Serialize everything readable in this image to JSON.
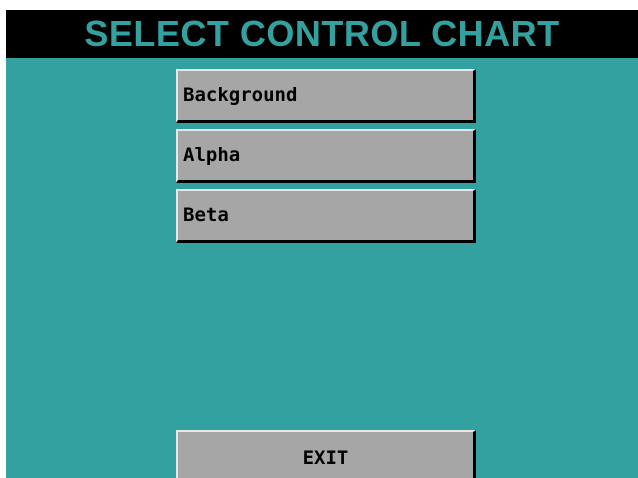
{
  "title": "SELECT CONTROL CHART",
  "menu": {
    "items": [
      {
        "label": "Background"
      },
      {
        "label": "Alpha"
      },
      {
        "label": "Beta"
      }
    ]
  },
  "exit_label": "EXIT",
  "colors": {
    "background": "#33a1a0",
    "title_bar": "#000000",
    "title_text": "#33a1a0",
    "button_face": "#a6a6a6",
    "button_text": "#000000"
  }
}
